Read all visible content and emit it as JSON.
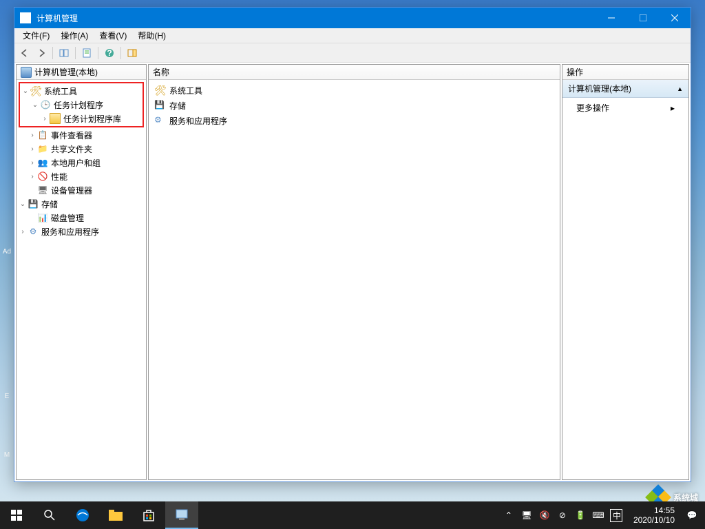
{
  "window": {
    "title": "计算机管理"
  },
  "menubar": {
    "file": "文件(F)",
    "action": "操作(A)",
    "view": "查看(V)",
    "help": "帮助(H)"
  },
  "left_panel": {
    "root": "计算机管理(本地)",
    "nodes": {
      "system_tools": "系统工具",
      "task_scheduler": "任务计划程序",
      "task_lib": "任务计划程序库",
      "event_viewer": "事件查看器",
      "shared_folders": "共享文件夹",
      "local_users": "本地用户和组",
      "performance": "性能",
      "device_mgr": "设备管理器",
      "storage": "存储",
      "disk_mgmt": "磁盘管理",
      "services": "服务和应用程序"
    }
  },
  "center": {
    "header": "名称",
    "items": {
      "system_tools": "系统工具",
      "storage": "存储",
      "services": "服务和应用程序"
    }
  },
  "right": {
    "header": "操作",
    "section": "计算机管理(本地)",
    "more": "更多操作"
  },
  "taskbar": {
    "time": "14:55",
    "date": "2020/10/10",
    "ime": "中"
  },
  "watermark": "系统城"
}
